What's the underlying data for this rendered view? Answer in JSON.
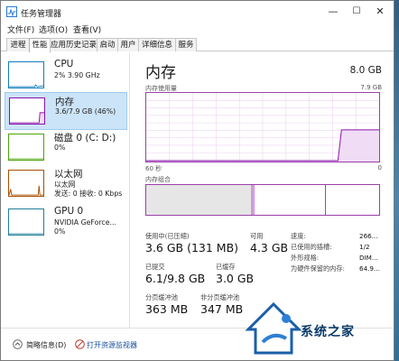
{
  "window": {
    "title": "任务管理器"
  },
  "menu": [
    "文件(F)",
    "选项(O)",
    "查看(V)"
  ],
  "tabs": [
    "进程",
    "性能",
    "应用历史记录",
    "启动",
    "用户",
    "详细信息",
    "服务"
  ],
  "active_tab": "性能",
  "sidebar": [
    {
      "title": "CPU",
      "line1": "2% 3.90 GHz",
      "line2": "",
      "color": "#117dbb"
    },
    {
      "title": "内存",
      "line1": "3.6/7.9 GB (46%)",
      "line2": "",
      "color": "#8b12ae",
      "selected": true
    },
    {
      "title": "磁盘 0 (C: D:)",
      "line1": "0%",
      "line2": "",
      "color": "#4da60c"
    },
    {
      "title": "以太网",
      "line1": "以太网",
      "line2": "发送: 0 接收: 0 Kbps",
      "color": "#a74f01"
    },
    {
      "title": "GPU 0",
      "line1": "NVIDIA GeForce...",
      "line2": "0%",
      "color": "#1f7f9a"
    }
  ],
  "main": {
    "title": "内存",
    "total": "8.0 GB",
    "usage_label": "内存使用量",
    "usage_max": "7.9 GB",
    "time_label": "60 秒",
    "time_end": "0",
    "composition_label": "内存组合",
    "usage_percent": 46
  },
  "stats": {
    "in_use_label": "使用中(已压缩)",
    "in_use_value": "3.6 GB (131 MB)",
    "available_label": "可用",
    "available_value": "4.3 GB",
    "committed_label": "已提交",
    "committed_value": "6.1/9.8 GB",
    "cached_label": "已缓存",
    "cached_value": "3.0 GB",
    "paged_label": "分页缓冲池",
    "paged_value": "363 MB",
    "nonpaged_label": "非分页缓冲池",
    "nonpaged_value": "347 MB"
  },
  "details": [
    {
      "key": "速度:",
      "value": "266..."
    },
    {
      "key": "已使用的插槽:",
      "value": "1/2"
    },
    {
      "key": "外形规格:",
      "value": "DIM..."
    },
    {
      "key": "为硬件保留的内存:",
      "value": "64.9..."
    }
  ],
  "bottom": {
    "fewer_details": "简略信息(D)",
    "open_monitor": "打开资源监视器"
  },
  "watermark": {
    "text": "系统之家"
  }
}
